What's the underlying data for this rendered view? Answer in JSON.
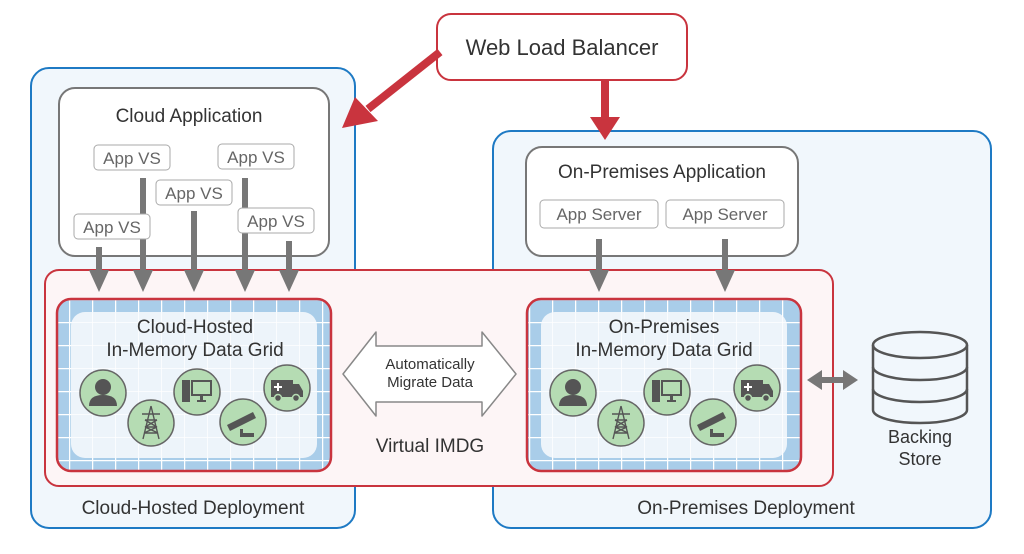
{
  "colors": {
    "red": "#c9343e",
    "blue": "#1e7ac4",
    "gray": "#777777",
    "text": "#333333",
    "icon_fill": "#b5dcb3",
    "grid_blue": "#a9cde9",
    "deploy_bg": "#f1f7fc",
    "virtual_bg": "#fdf5f6"
  },
  "load_balancer": {
    "label": "Web Load Balancer"
  },
  "cloud_deployment": {
    "label": "Cloud-Hosted Deployment",
    "application": {
      "title": "Cloud Application",
      "servers": [
        "App VS",
        "App VS",
        "App VS",
        "App VS",
        "App VS"
      ]
    },
    "grid": {
      "title_line1": "Cloud-Hosted",
      "title_line2": "In-Memory Data Grid",
      "icons": [
        "person-icon",
        "power-tower-icon",
        "computer-icon",
        "security-camera-icon",
        "ambulance-icon"
      ]
    }
  },
  "onprem_deployment": {
    "label": "On-Premises Deployment",
    "application": {
      "title": "On-Premises Application",
      "servers": [
        "App Server",
        "App Server"
      ]
    },
    "grid": {
      "title_line1": "On-Premises",
      "title_line2": "In-Memory Data Grid",
      "icons": [
        "person-icon",
        "power-tower-icon",
        "computer-icon",
        "security-camera-icon",
        "ambulance-icon"
      ]
    },
    "backing_store": {
      "line1": "Backing",
      "line2": "Store"
    }
  },
  "virtual_imdg": {
    "label": "Virtual IMDG",
    "migrate_line1": "Automatically",
    "migrate_line2": "Migrate Data"
  }
}
